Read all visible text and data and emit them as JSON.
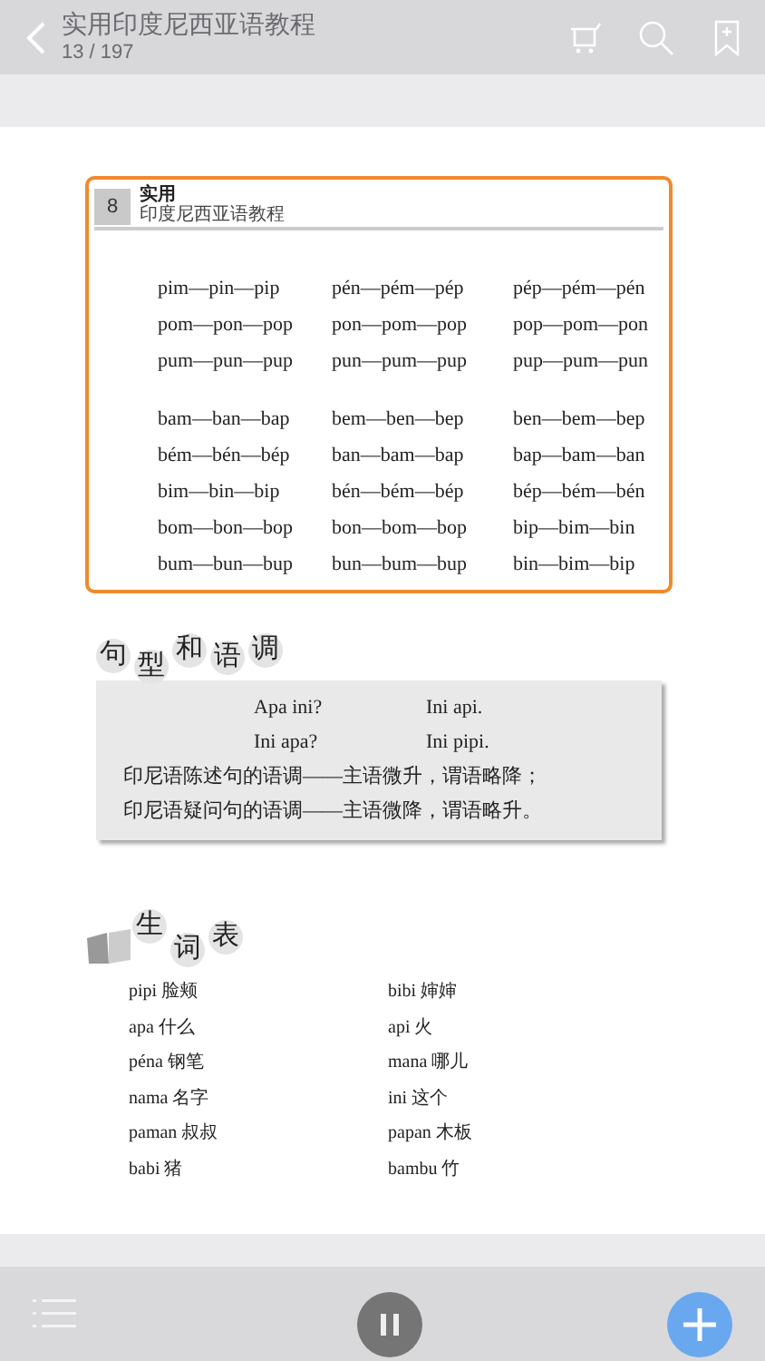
{
  "header": {
    "title": "实用印度尼西亚语教程",
    "page": "13 / 197"
  },
  "page_header": {
    "number": "8",
    "title": "实用",
    "subtitle": "印度尼西亚语教程"
  },
  "drill_groups": [
    [
      [
        "pim—pin—pip",
        "pén—pém—pép",
        "pép—pém—pén"
      ],
      [
        "pom—pon—pop",
        "pon—pom—pop",
        "pop—pom—pon"
      ],
      [
        "pum—pun—pup",
        "pun—pum—pup",
        "pup—pum—pun"
      ]
    ],
    [
      [
        "bam—ban—bap",
        "bem—ben—bep",
        "ben—bem—bep"
      ],
      [
        "bém—bén—bép",
        "ban—bam—bap",
        "bap—bam—ban"
      ],
      [
        "bim—bin—bip",
        "bén—bém—bép",
        "bép—bém—bén"
      ],
      [
        "bom—bon—bop",
        "bon—bom—bop",
        "bip—bim—bin"
      ],
      [
        "bum—bun—bup",
        "bun—bum—bup",
        "bin—bim—bip"
      ]
    ]
  ],
  "sentence_section": {
    "title_chars": [
      "句",
      "型",
      "和",
      "语",
      "调"
    ],
    "pairs": [
      [
        "Apa ini?",
        "Ini api."
      ],
      [
        "Ini apa?",
        "Ini pipi."
      ]
    ],
    "notes": [
      "印尼语陈述句的语调——主语微升，谓语略降；",
      "印尼语疑问句的语调——主语微降，谓语略升。"
    ]
  },
  "vocabulary": {
    "title_chars": [
      "生",
      "词",
      "表"
    ],
    "items": [
      "pipi 脸颊",
      "bibi 婶婶",
      "apa 什么",
      "api 火",
      "péna 钢笔",
      "mana 哪儿",
      "nama 名字",
      "ini 这个",
      "paman 叔叔",
      "papan 木板",
      "babi 猪",
      "bambu 竹"
    ]
  }
}
